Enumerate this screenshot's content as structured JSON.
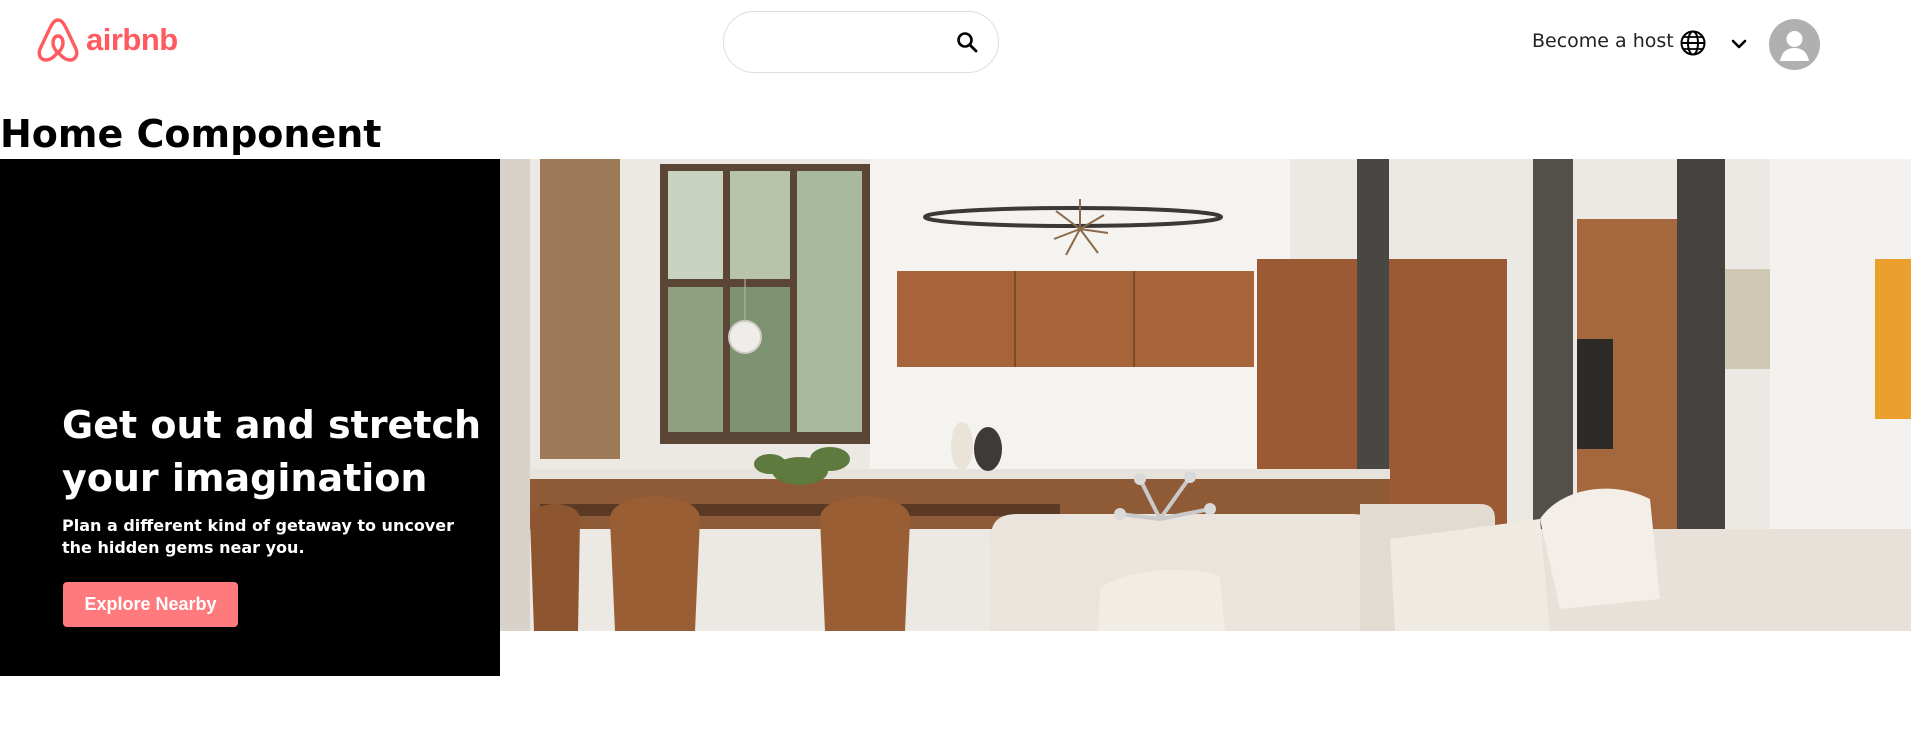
{
  "header": {
    "logo_text": "airbnb",
    "search": {
      "value": "",
      "placeholder": ""
    },
    "host_link": "Become a host",
    "icons": {
      "logo": "airbnb-logo-icon",
      "search": "search-icon",
      "language": "globe-icon",
      "menu": "chevron-down-icon",
      "profile": "avatar-icon"
    }
  },
  "page": {
    "heading": "Home Component"
  },
  "hero": {
    "title": "Get out and stretch your imagination",
    "subtitle": "Plan a different kind of getaway to uncover the hidden gems near you.",
    "button_label": "Explore Nearby",
    "image_subject": "modern kitchen and living room interior"
  },
  "colors": {
    "brand": "#FF5A5F",
    "button": "#FF7A7D",
    "hero_panel": "#000000",
    "avatar": "#B0B0B0"
  }
}
